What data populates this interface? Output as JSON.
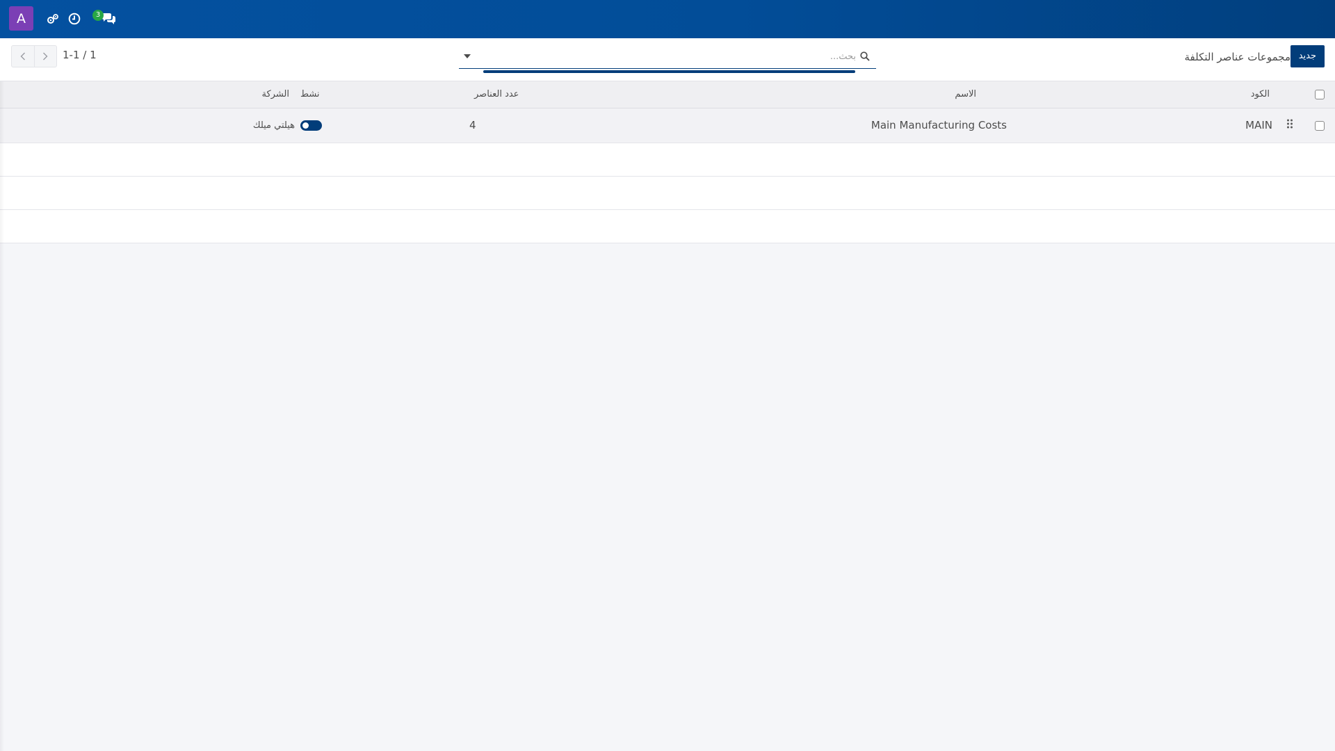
{
  "navbar": {
    "avatar_letter": "A",
    "icons": [
      "gears-icon",
      "clock-icon",
      "chat-icon"
    ],
    "message_count": "3",
    "bg_color": "#024d98",
    "avatar_color": "#7b3fb5"
  },
  "control_panel": {
    "new_button_label": "جديد",
    "title": "مجموعات عناصر التكلفة",
    "search_placeholder": "بحث...",
    "pager_value": "1-1 / 1",
    "accent_color": "#023d7a"
  },
  "table": {
    "columns": {
      "code": "الكود",
      "name": "الاسم",
      "element_count": "عدد العناصر",
      "active": "نشط",
      "company": "الشركة"
    },
    "rows": [
      {
        "code": "MAIN",
        "name": "Main Manufacturing Costs",
        "element_count": "4",
        "active": true,
        "company": "هيلتي ميلك"
      }
    ]
  }
}
